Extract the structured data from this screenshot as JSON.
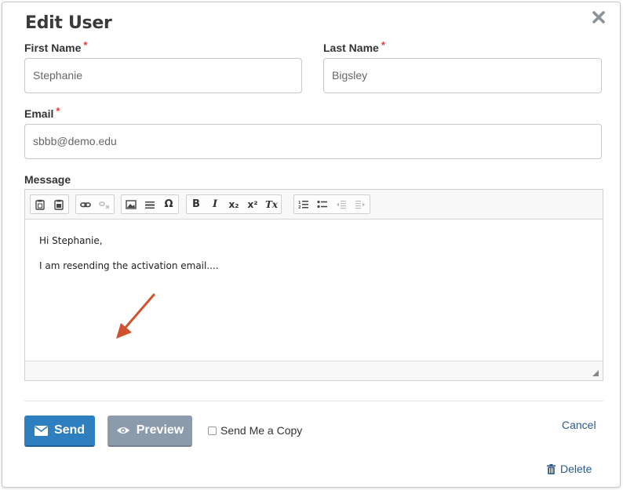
{
  "dialog": {
    "title": "Edit User",
    "close_icon": "close-icon"
  },
  "form": {
    "first_name": {
      "label": "First Name",
      "required_mark": "*",
      "value": "Stephanie"
    },
    "last_name": {
      "label": "Last Name",
      "required_mark": "*",
      "value": "Bigsley"
    },
    "email": {
      "label": "Email",
      "required_mark": "*",
      "value": "sbbb@demo.edu"
    },
    "message": {
      "label": "Message",
      "toolbar_groups": [
        [
          "paste-icon",
          "paste-from-word-icon"
        ],
        [
          "link-icon",
          "unlink-icon"
        ],
        [
          "image-icon",
          "horizontal-rule-icon",
          "special-character-icon"
        ],
        [
          "bold-icon",
          "italic-icon",
          "subscript-icon",
          "superscript-icon",
          "remove-format-icon"
        ],
        [
          "numbered-list-icon",
          "bulleted-list-icon",
          "decrease-indent-icon",
          "increase-indent-icon"
        ]
      ],
      "toolbar_glyphs": {
        "special_character": "Ω",
        "bold": "B",
        "italic": "I",
        "subscript": "x₂",
        "superscript": "x²",
        "remove_format": "Tx"
      },
      "body_lines": [
        "Hi Stephanie,",
        "I am resending the activation email...."
      ]
    }
  },
  "footer": {
    "send_label": "Send",
    "preview_label": "Preview",
    "copy_label": "Send Me a Copy",
    "copy_checked": false,
    "cancel_label": "Cancel",
    "delete_label": "Delete"
  },
  "colors": {
    "primary": "#2e7fbf",
    "secondary": "#8c9bab",
    "required": "#e03b3b",
    "link": "#2a5a8a",
    "arrow_annotation": "#d0522c"
  }
}
